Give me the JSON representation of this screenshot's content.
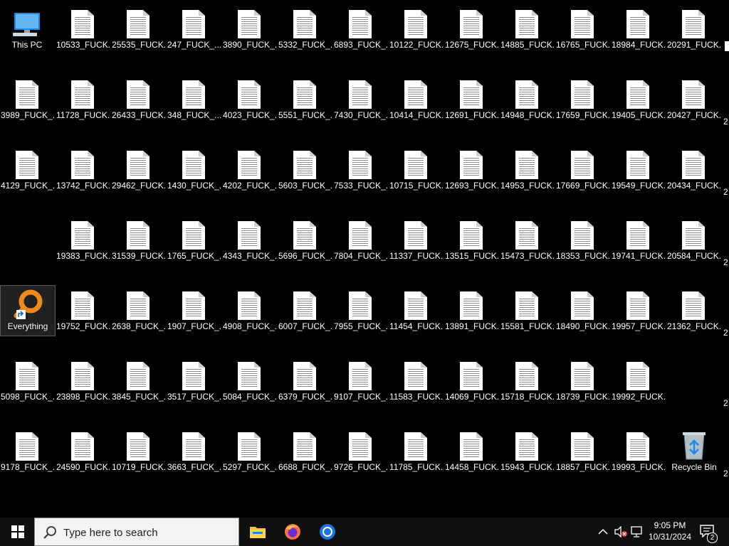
{
  "desktop": {
    "this_pc": "This PC",
    "everything": "Everything",
    "recycle_bin": "Recycle Bin",
    "files": [
      [
        "10533_FUCK...",
        "25535_FUCK...",
        "247_FUCK_...",
        "3890_FUCK_...",
        "5332_FUCK_...",
        "6893_FUCK_...",
        "10122_FUCK...",
        "12675_FUCK...",
        "14885_FUCK...",
        "16765_FUCK...",
        "18984_FUCK...",
        "20291_FUCK..."
      ],
      [
        "3989_FUCK_...",
        "11728_FUCK...",
        "26433_FUCK...",
        "348_FUCK_...",
        "4023_FUCK_...",
        "5551_FUCK_...",
        "7430_FUCK_...",
        "10414_FUCK...",
        "12691_FUCK...",
        "14948_FUCK...",
        "17659_FUCK...",
        "19405_FUCK...",
        "20427_FUCK..."
      ],
      [
        "4129_FUCK_...",
        "13742_FUCK...",
        "29462_FUCK...",
        "1430_FUCK_...",
        "4202_FUCK_...",
        "5603_FUCK_...",
        "7533_FUCK_...",
        "10715_FUCK...",
        "12693_FUCK...",
        "14953_FUCK...",
        "17669_FUCK...",
        "19549_FUCK...",
        "20434_FUCK..."
      ],
      [
        "19383_FUCK...",
        "31539_FUCK...",
        "1765_FUCK_...",
        "4343_FUCK_...",
        "5696_FUCK_...",
        "7804_FUCK_...",
        "11337_FUCK...",
        "13515_FUCK...",
        "15473_FUCK...",
        "18353_FUCK...",
        "19741_FUCK...",
        "20584_FUCK..."
      ],
      [
        "19752_FUCK...",
        "2638_FUCK_...",
        "1907_FUCK_...",
        "4908_FUCK_...",
        "6007_FUCK_...",
        "7955_FUCK_...",
        "11454_FUCK...",
        "13891_FUCK...",
        "15581_FUCK...",
        "18490_FUCK...",
        "19957_FUCK...",
        "21362_FUCK..."
      ],
      [
        "5098_FUCK_...",
        "23898_FUCK...",
        "3845_FUCK_...",
        "3517_FUCK_...",
        "5084_FUCK_...",
        "6379_FUCK_...",
        "9107_FUCK_...",
        "11583_FUCK...",
        "14069_FUCK...",
        "15718_FUCK...",
        "18739_FUCK...",
        "19992_FUCK..."
      ],
      [
        "9178_FUCK_...",
        "24590_FUCK...",
        "10719_FUCK...",
        "3663_FUCK_...",
        "5297_FUCK_...",
        "6688_FUCK_...",
        "9726_FUCK_...",
        "11785_FUCK...",
        "14458_FUCK...",
        "15943_FUCK...",
        "18857_FUCK...",
        "19993_FUCK..."
      ]
    ],
    "edge_labels": [
      "2",
      "2",
      "2",
      "2",
      "2",
      "2"
    ]
  },
  "taskbar": {
    "search_placeholder": "Type here to search",
    "time": "9:05 PM",
    "date": "10/31/2024",
    "notification_count": "2"
  },
  "colors": {
    "desktop_bg": "#000000",
    "taskbar_bg": "#101010",
    "everything_orange": "#f08a1c",
    "chrome_blue": "#1a73e8",
    "folder_yellow": "#f4c430"
  },
  "icons": {
    "start": "windows-logo-icon",
    "search": "magnifier-icon",
    "file_explorer": "folder-icon",
    "firefox": "firefox-icon",
    "chrome": "chrome-icon",
    "tray": [
      "chevron-up-icon",
      "volume-muted-icon",
      "network-icon",
      "notification-icon"
    ]
  }
}
